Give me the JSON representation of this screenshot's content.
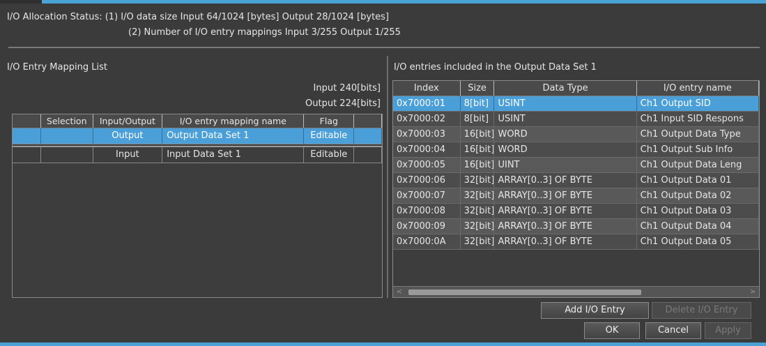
{
  "status": {
    "line1": "I/O Allocation Status: (1) I/O data size Input 64/1024 [bytes] Output 28/1024 [bytes]",
    "line2": "(2) Number of I/O entry mappings Input 3/255 Output 1/255"
  },
  "left_panel": {
    "title": "I/O Entry Mapping List",
    "input_bits": "Input 240[bits]",
    "output_bits": "Output 224[bits]",
    "columns": [
      "",
      "Selection",
      "Input/Output",
      "I/O entry mapping name",
      "Flag",
      ""
    ],
    "rows": [
      {
        "selection": "",
        "io": "Output",
        "name": "Output Data Set 1",
        "flag": "Editable",
        "selected": true
      },
      {
        "selection": "",
        "io": "Input",
        "name": "Input Data Set 1",
        "flag": "Editable",
        "selected": false
      }
    ]
  },
  "right_panel": {
    "title": "I/O entries included in the Output Data Set 1",
    "columns": [
      "Index",
      "Size",
      "Data Type",
      "I/O entry name"
    ],
    "rows": [
      {
        "index": "0x7000:01",
        "size": "8[bit]",
        "type": "USINT",
        "name": "Ch1 Output SID"
      },
      {
        "index": "0x7000:02",
        "size": "8[bit]",
        "type": "USINT",
        "name": "Ch1 Input SID Respons"
      },
      {
        "index": "0x7000:03",
        "size": "16[bit]",
        "type": "WORD",
        "name": "Ch1 Output Data Type"
      },
      {
        "index": "0x7000:04",
        "size": "16[bit]",
        "type": "WORD",
        "name": "Ch1 Output Sub Info"
      },
      {
        "index": "0x7000:05",
        "size": "16[bit]",
        "type": "UINT",
        "name": "Ch1 Output Data Leng"
      },
      {
        "index": "0x7000:06",
        "size": "32[bit]",
        "type": "ARRAY[0..3] OF BYTE",
        "name": "Ch1 Output Data 01"
      },
      {
        "index": "0x7000:07",
        "size": "32[bit]",
        "type": "ARRAY[0..3] OF BYTE",
        "name": "Ch1 Output Data 02"
      },
      {
        "index": "0x7000:08",
        "size": "32[bit]",
        "type": "ARRAY[0..3] OF BYTE",
        "name": "Ch1 Output Data 03"
      },
      {
        "index": "0x7000:09",
        "size": "32[bit]",
        "type": "ARRAY[0..3] OF BYTE",
        "name": "Ch1 Output Data 04"
      },
      {
        "index": "0x7000:0A",
        "size": "32[bit]",
        "type": "ARRAY[0..3] OF BYTE",
        "name": "Ch1 Output Data 05"
      }
    ],
    "scroll_left": "<",
    "scroll_right": ">"
  },
  "buttons": {
    "add_io_entry": "Add I/O Entry",
    "delete_io_entry": "Delete I/O Entry",
    "ok": "OK",
    "cancel": "Cancel",
    "apply": "Apply"
  },
  "colors": {
    "accent": "#4aa3d6",
    "selection": "#4a9fd8",
    "background": "#3b3b3b"
  }
}
